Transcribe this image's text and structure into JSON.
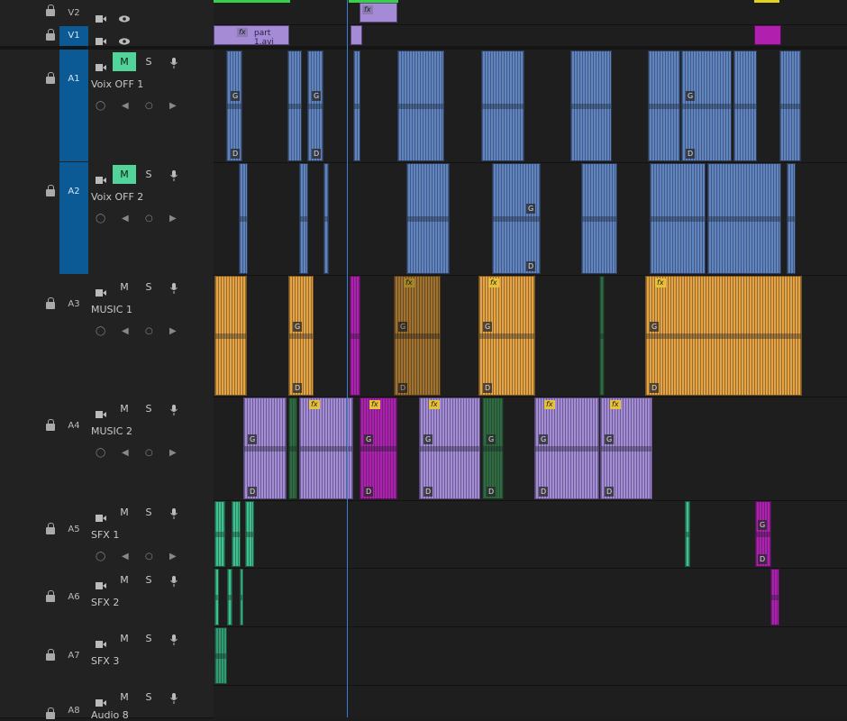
{
  "video_tracks": [
    {
      "tag": "V2",
      "blue": false
    },
    {
      "tag": "V1",
      "blue": true
    }
  ],
  "audio_tracks": [
    {
      "tag": "A1",
      "name": "Voix OFF 1",
      "mute_on": true,
      "blue": true
    },
    {
      "tag": "A2",
      "name": "Voix OFF 2",
      "mute_on": true,
      "blue": true
    },
    {
      "tag": "A3",
      "name": "MUSIC 1",
      "mute_on": false,
      "blue": false
    },
    {
      "tag": "A4",
      "name": "MUSIC 2",
      "mute_on": false,
      "blue": false
    },
    {
      "tag": "A5",
      "name": "SFX 1",
      "mute_on": false,
      "blue": false
    },
    {
      "tag": "A6",
      "name": "SFX 2",
      "mute_on": false,
      "blue": false
    },
    {
      "tag": "A7",
      "name": "SFX 3",
      "mute_on": false,
      "blue": false
    },
    {
      "tag": "A8",
      "name": "Audio 8",
      "mute_on": false,
      "blue": false
    }
  ],
  "buttons": {
    "mute": "M",
    "solo": "S"
  },
  "clip_labels": {
    "video_clip": "part 1.avi",
    "fx": "fx",
    "gain": "G",
    "duck": "D"
  },
  "colors": {
    "blue_track": "#0b5a96",
    "mute_on": "#52d39a",
    "voice": "#5f84bf",
    "music1": "#e8a33f",
    "music2": "#a58bd6",
    "sfx": "#3ec28c",
    "magenta": "#b01fae",
    "playhead": "#3a7bd5"
  }
}
